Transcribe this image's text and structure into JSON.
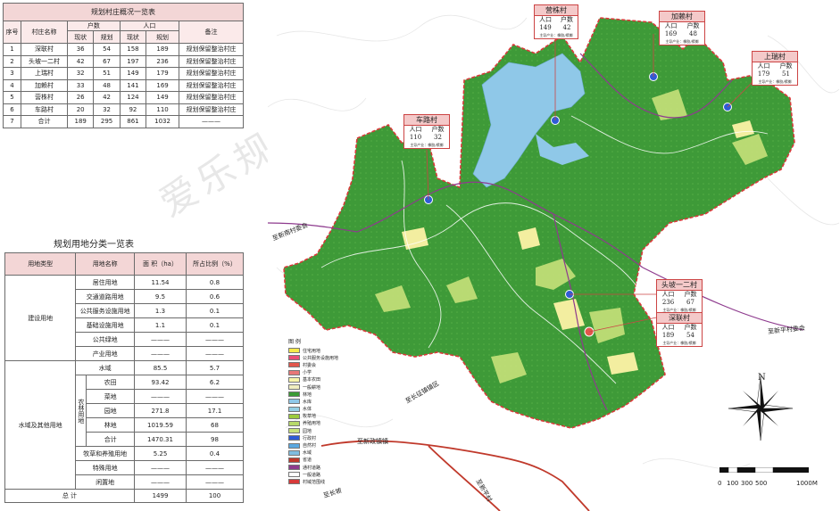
{
  "village_table": {
    "title": "规划村庄概况一览表",
    "headers": {
      "no": "序号",
      "name": "村庄名称",
      "households": "户数",
      "population": "人口",
      "current": "现状",
      "planned": "规划",
      "note": "备注"
    },
    "rows": [
      {
        "no": "1",
        "name": "深联村",
        "h_now": "36",
        "h_plan": "54",
        "p_now": "158",
        "p_plan": "189",
        "note": "规划保留整治村庄"
      },
      {
        "no": "2",
        "name": "头坡一二村",
        "h_now": "42",
        "h_plan": "67",
        "p_now": "197",
        "p_plan": "236",
        "note": "规划保留整治村庄"
      },
      {
        "no": "3",
        "name": "上瑞村",
        "h_now": "32",
        "h_plan": "51",
        "p_now": "149",
        "p_plan": "179",
        "note": "规划保留整治村庄"
      },
      {
        "no": "4",
        "name": "加赖村",
        "h_now": "33",
        "h_plan": "48",
        "p_now": "141",
        "p_plan": "169",
        "note": "规划保留整治村庄"
      },
      {
        "no": "5",
        "name": "营株村",
        "h_now": "26",
        "h_plan": "42",
        "p_now": "124",
        "p_plan": "149",
        "note": "规划保留整治村庄"
      },
      {
        "no": "6",
        "name": "车路村",
        "h_now": "20",
        "h_plan": "32",
        "p_now": "92",
        "p_plan": "110",
        "note": "规划保留整治村庄"
      },
      {
        "no": "7",
        "name": "合计",
        "h_now": "189",
        "h_plan": "295",
        "p_now": "861",
        "p_plan": "1032",
        "note": "———"
      }
    ]
  },
  "land_table": {
    "title": "规划用地分类一览表",
    "headers": {
      "type": "用地类型",
      "name": "用地名称",
      "area": "面  积（ha）",
      "ratio": "所占比例（%）"
    },
    "group_construction": "建设用地",
    "group_water": "水域及其他用地",
    "group_agri": "农林用地",
    "construction_rows": [
      {
        "name": "居住用地",
        "area": "11.54",
        "ratio": "0.8"
      },
      {
        "name": "交通道路用地",
        "area": "9.5",
        "ratio": "0.6"
      },
      {
        "name": "公共服务设施用地",
        "area": "1.3",
        "ratio": "0.1"
      },
      {
        "name": "基础设施用地",
        "area": "1.1",
        "ratio": "0.1"
      },
      {
        "name": "公共绿地",
        "area": "———",
        "ratio": "———"
      },
      {
        "name": "产业用地",
        "area": "———",
        "ratio": "———"
      }
    ],
    "water_row": {
      "name": "水域",
      "area": "85.5",
      "ratio": "5.7"
    },
    "agri_rows": [
      {
        "name": "农田",
        "area": "93.42",
        "ratio": "6.2"
      },
      {
        "name": "菜地",
        "area": "———",
        "ratio": "———"
      },
      {
        "name": "园地",
        "area": "271.8",
        "ratio": "17.1"
      },
      {
        "name": "林地",
        "area": "1019.59",
        "ratio": "68"
      },
      {
        "name": "合计",
        "area": "1470.31",
        "ratio": "98"
      }
    ],
    "other_rows": [
      {
        "name": "牧草和养殖用地",
        "area": "5.25",
        "ratio": "0.4"
      },
      {
        "name": "特殊用地",
        "area": "———",
        "ratio": "———"
      },
      {
        "name": "闲置地",
        "area": "———",
        "ratio": "———"
      }
    ],
    "total": {
      "name": "总  计",
      "area": "1499",
      "ratio": "100"
    }
  },
  "watermark": "爱乐规划",
  "map": {
    "villages": [
      {
        "name": "营株村",
        "pop_label": "人口",
        "hh_label": "户数",
        "pop": "149",
        "hh": "42"
      },
      {
        "name": "加赖村",
        "pop_label": "人口",
        "hh_label": "户数",
        "pop": "169",
        "hh": "48"
      },
      {
        "name": "上瑞村",
        "pop_label": "人口",
        "hh_label": "户数",
        "pop": "179",
        "hh": "51",
        "note": "主导产业：橡胶/槟榔"
      },
      {
        "name": "车路村",
        "pop_label": "人口",
        "hh_label": "户数",
        "pop": "110",
        "hh": "32",
        "note": "主导产业：橡胶/槟榔"
      },
      {
        "name": "头坡一二村",
        "pop_label": "人口",
        "hh_label": "户数",
        "pop": "236",
        "hh": "67",
        "note": "主导产业：橡胶/槟榔"
      },
      {
        "name": "深联村",
        "pop_label": "人口",
        "hh_label": "户数",
        "pop": "189",
        "hh": "54",
        "note": "主导产业：橡胶/槟榔"
      }
    ],
    "vnote_common": "主导产业：橡胶/槟榔",
    "roads": {
      "north": "至新南村委会",
      "east": "至新平村委会",
      "southwest": "至长征镇镇区",
      "south_a": "至新政镇镇",
      "south_b": "至长坡",
      "south_c": "至新平村"
    },
    "legend_title": "图 例",
    "legend": [
      {
        "label": "住宅用地",
        "color": "#f5e94a"
      },
      {
        "label": "公共服务设施用地",
        "color": "#e94d77"
      },
      {
        "label": "村委会",
        "color": "#e2564c"
      },
      {
        "label": "小学",
        "color": "#e87777"
      },
      {
        "label": "基本农田",
        "color": "#f7f4a8"
      },
      {
        "label": "一般耕地",
        "color": "#f0eec0"
      },
      {
        "label": "林地",
        "color": "#3b9b35"
      },
      {
        "label": "水库",
        "color": "#8fc8e8"
      },
      {
        "label": "水体",
        "color": "#94cfe4"
      },
      {
        "label": "牧草地",
        "color": "#9ccb3d"
      },
      {
        "label": "养殖用地",
        "color": "#b7d96a"
      },
      {
        "label": "园地",
        "color": "#c7e17a"
      },
      {
        "label": "行政村",
        "color": "#2f5bd6"
      },
      {
        "label": "自然村",
        "color": "#5ba8e0"
      },
      {
        "label": "水域",
        "color": "#7fbde0"
      },
      {
        "label": "省道",
        "color": "#c0392b"
      },
      {
        "label": "通村道路",
        "color": "#8e3b8e"
      },
      {
        "label": "一般道路",
        "color": "#ffffff"
      },
      {
        "label": "村域范围线",
        "color": "#d83a3a"
      }
    ],
    "north_label": "N",
    "scale_labels": [
      "0",
      "100",
      "300",
      "500",
      "1000M"
    ]
  }
}
